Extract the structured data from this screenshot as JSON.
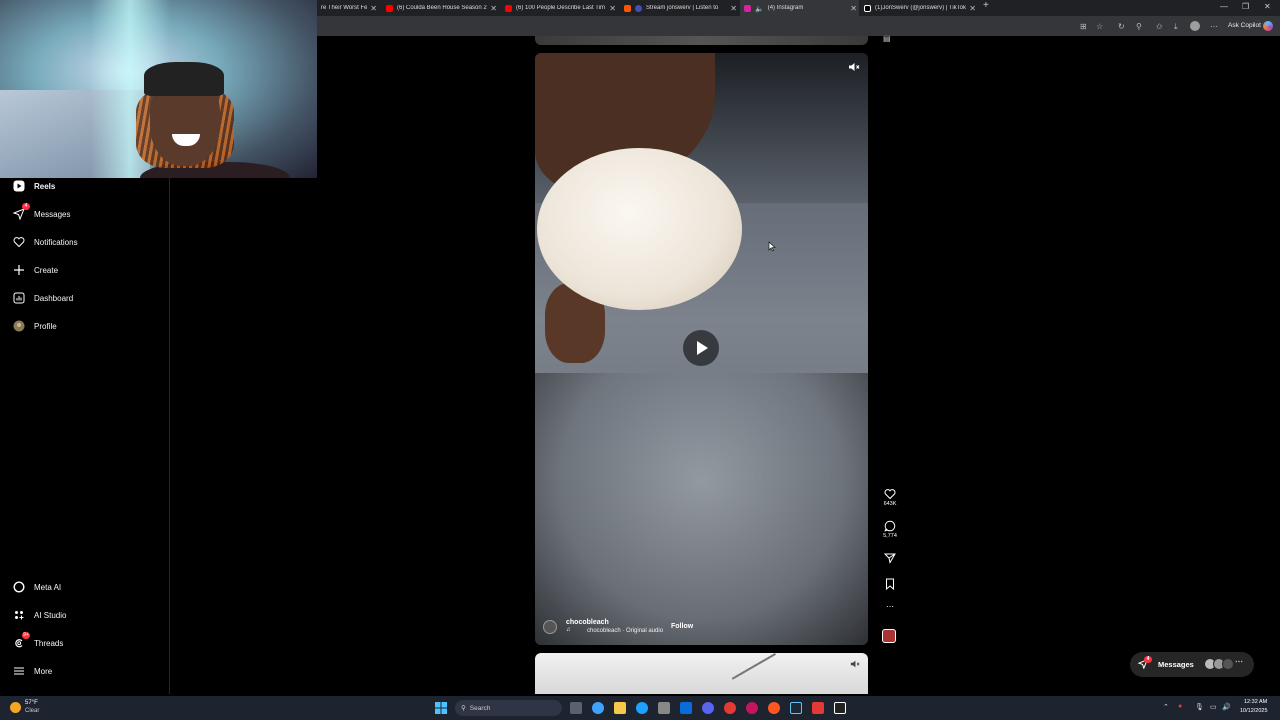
{
  "browser": {
    "tabs": [
      {
        "label": "re Their Worst Fe",
        "icon_color": "#888888"
      },
      {
        "label": "(6) Coulda Been House Season 2",
        "icon_color": "#ff0000"
      },
      {
        "label": "(6) 100 People Describe Last Tim",
        "icon_color": "#ff0000"
      },
      {
        "label": "Stream jonswerv | Listen to",
        "icon_color": "#ff5500"
      },
      {
        "label": "(4) Instagram",
        "icon_color": "#d6249f"
      },
      {
        "label": "(1)JonSwerv (@jonswerv) | TikTok",
        "icon_color": "#ffffff"
      }
    ],
    "new_tab": "+",
    "ask_copilot": "Ask Copilot"
  },
  "sidebar": {
    "items": [
      {
        "label": "Reels",
        "icon": "reels-icon",
        "bold": true
      },
      {
        "label": "Messages",
        "icon": "messages-icon",
        "badge": "4"
      },
      {
        "label": "Notifications",
        "icon": "heart-icon"
      },
      {
        "label": "Create",
        "icon": "plus-icon"
      },
      {
        "label": "Dashboard",
        "icon": "dashboard-icon"
      },
      {
        "label": "Profile",
        "icon": "profile-avatar-icon"
      }
    ],
    "bottom_items": [
      {
        "label": "Meta AI",
        "icon": "meta-ai-icon"
      },
      {
        "label": "AI Studio",
        "icon": "ai-studio-icon"
      },
      {
        "label": "Threads",
        "icon": "threads-icon",
        "badge": "9+"
      },
      {
        "label": "More",
        "icon": "menu-icon"
      }
    ]
  },
  "reel": {
    "username": "chocobleach",
    "audio": "chocobleach · Original audio",
    "follow": "Follow",
    "likes": "643K",
    "comments": "5,774"
  },
  "messages_pill": {
    "label": "Messages",
    "badge": "4"
  },
  "taskbar": {
    "temperature": "57°F",
    "condition": "Clear",
    "search": "Search",
    "time": "12:32 AM",
    "date": "10/12/2025"
  },
  "colors": {
    "accent_badge": "#ff3040",
    "sidebar_bg": "#000000",
    "taskbar_bg": "#1e2330"
  }
}
